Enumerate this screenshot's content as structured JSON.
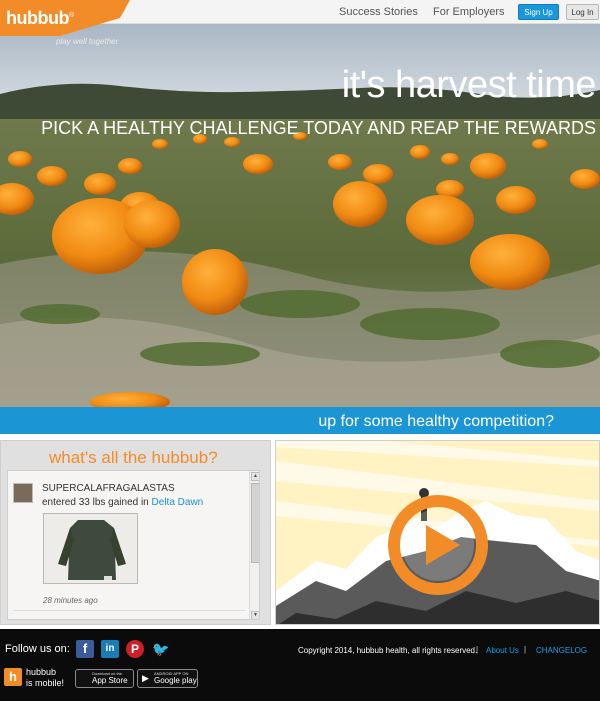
{
  "logo": {
    "wordmark": "hubbub",
    "trademark": "®",
    "tagline": "play well together"
  },
  "nav": {
    "links": [
      "Success Stories",
      "For Employers"
    ],
    "signup_label": "Sign Up",
    "login_label": "Log In"
  },
  "hero": {
    "title": "it's harvest time",
    "subtitle": "PICK A HEALTHY CHALLENGE TODAY AND REAP THE REWARDS"
  },
  "band": {
    "text": "up for some healthy competition?"
  },
  "feed": {
    "title": "what's all the hubbub?",
    "items": [
      {
        "user": "SUPERCALAFRAGALASTAS",
        "action": "entered 33 lbs gained in",
        "challenge": "Delta Dawn",
        "time": "28 minutes ago"
      }
    ]
  },
  "video": {
    "play_icon": "play-icon"
  },
  "footer": {
    "follow_label": "Follow us on:",
    "social": [
      {
        "name": "facebook",
        "glyph": "f"
      },
      {
        "name": "linkedin",
        "glyph": "in"
      },
      {
        "name": "pinterest",
        "glyph": "P"
      },
      {
        "name": "twitter",
        "glyph": "🐦"
      }
    ],
    "copyright": "Copyright 2014, hubbub health, all rights reserved.",
    "separator": "|",
    "about_label": "About Us",
    "changelog_label": "CHANGELOG",
    "mobile_line1": "hubbub",
    "mobile_line2": "is mobile!",
    "mobile_icon_glyph": "h",
    "appstore_small": "Download on the",
    "appstore_big": "App Store",
    "googleplay_small": "ANDROID APP ON",
    "googleplay_big": "Google play"
  },
  "colors": {
    "brand_orange": "#f28c28",
    "brand_blue": "#1b95d3",
    "footer_bg": "#0b0b0b"
  }
}
